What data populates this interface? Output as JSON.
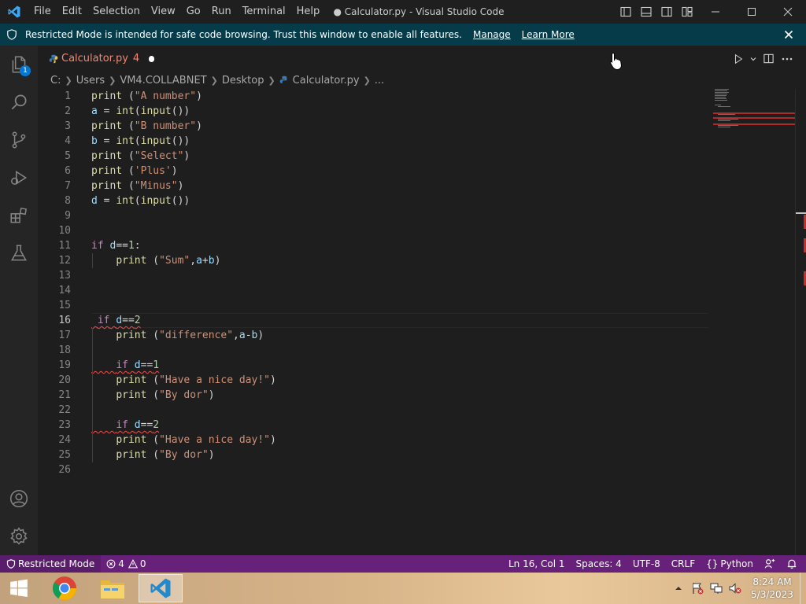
{
  "window": {
    "title": "● Calculator.py - Visual Studio Code",
    "menu": [
      "File",
      "Edit",
      "Selection",
      "View",
      "Go",
      "Run",
      "Terminal",
      "Help"
    ],
    "icons": [
      "toggle-primary-sidebar-icon",
      "toggle-panel-icon",
      "toggle-secondary-sidebar-icon",
      "customize-layout-icon",
      "minimize-icon",
      "maximize-icon",
      "close-icon"
    ]
  },
  "banner": {
    "message": "Restricted Mode is intended for safe code browsing. Trust this window to enable all features.",
    "manage": "Manage",
    "learn_more": "Learn More"
  },
  "activity_bar": {
    "items": [
      "explorer-icon",
      "search-icon",
      "source-control-icon",
      "run-debug-icon",
      "extensions-icon",
      "testing-icon"
    ],
    "bottom": [
      "accounts-icon",
      "manage-gear-icon"
    ],
    "explorer_badge": "1"
  },
  "tab": {
    "name": "Calculator.py",
    "problems": "4",
    "dirty": true
  },
  "breadcrumb": {
    "parts": [
      "C:",
      "Users",
      "VM4.COLLABNET",
      "Desktop"
    ],
    "file": "Calculator.py",
    "more": "..."
  },
  "editor": {
    "active_line": 16,
    "lines": [
      {
        "n": "1",
        "code": "print (\"A number\")"
      },
      {
        "n": "2",
        "code": "a = int(input())"
      },
      {
        "n": "3",
        "code": "print (\"B number\")"
      },
      {
        "n": "4",
        "code": "b = int(input())"
      },
      {
        "n": "5",
        "code": "print (\"Select\")"
      },
      {
        "n": "6",
        "code": "print ('Plus')"
      },
      {
        "n": "7",
        "code": "print (\"Minus\")"
      },
      {
        "n": "8",
        "code": "d = int(input())"
      },
      {
        "n": "9",
        "code": ""
      },
      {
        "n": "10",
        "code": ""
      },
      {
        "n": "11",
        "code": "if d==1:"
      },
      {
        "n": "12",
        "code": "    print (\"Sum\",a+b)"
      },
      {
        "n": "13",
        "code": ""
      },
      {
        "n": "14",
        "code": ""
      },
      {
        "n": "15",
        "code": ""
      },
      {
        "n": "16",
        "code": " if d==2"
      },
      {
        "n": "17",
        "code": "    print (\"difference\",a-b)"
      },
      {
        "n": "18",
        "code": ""
      },
      {
        "n": "19",
        "code": "    if d==1"
      },
      {
        "n": "20",
        "code": "    print (\"Have a nice day!\")"
      },
      {
        "n": "21",
        "code": "    print (\"By dor\")"
      },
      {
        "n": "22",
        "code": ""
      },
      {
        "n": "23",
        "code": "    if d==2"
      },
      {
        "n": "24",
        "code": "    print (\"Have a nice day!\")"
      },
      {
        "n": "25",
        "code": "    print (\"By dor\")"
      },
      {
        "n": "26",
        "code": ""
      }
    ]
  },
  "statusbar": {
    "restricted": "Restricted Mode",
    "errors": "4",
    "warnings": "0",
    "position": "Ln 16, Col 1",
    "spaces": "Spaces: 4",
    "encoding": "UTF-8",
    "eol": "CRLF",
    "language": "Python"
  },
  "taskbar": {
    "apps": [
      "windows-start-icon",
      "chrome-icon",
      "file-explorer-icon",
      "vscode-icon"
    ],
    "time": "8:24 AM",
    "date": "5/3/2023"
  },
  "colors": {
    "statusbar": "#68217a",
    "banner": "#063b49",
    "keyword": "#c586c0",
    "function": "#dcdcaa",
    "string": "#ce9178",
    "variable": "#9cdcfe",
    "number": "#b5cea8",
    "error": "#f14c4c"
  }
}
